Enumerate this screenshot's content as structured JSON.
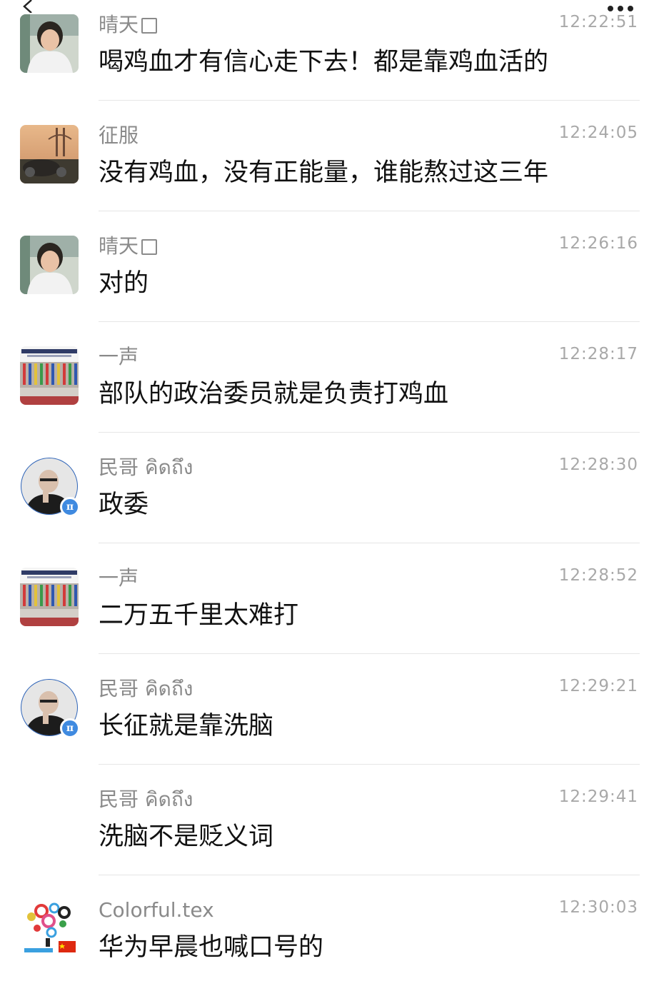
{
  "messages": [
    {
      "sender": "晴天",
      "sender_has_box": true,
      "time": "12:22:51",
      "text": "喝鸡血才有信心走下去！都是靠鸡血活的",
      "avatar": "avatar-woman"
    },
    {
      "sender": "征服",
      "sender_has_box": false,
      "time": "12:24:05",
      "text": "没有鸡血，没有正能量，谁能熬过这三年",
      "avatar": "avatar-landscape"
    },
    {
      "sender": "晴天",
      "sender_has_box": true,
      "time": "12:26:16",
      "text": "对的",
      "avatar": "avatar-woman"
    },
    {
      "sender": "一声",
      "sender_has_box": false,
      "time": "12:28:17",
      "text": "部队的政治委员就是负责打鸡血",
      "avatar": "avatar-summit"
    },
    {
      "sender": "民哥 คิดถึง",
      "sender_has_box": false,
      "time": "12:28:30",
      "text": "政委",
      "avatar": "avatar-man"
    },
    {
      "sender": "一声",
      "sender_has_box": false,
      "time": "12:28:52",
      "text": "二万五千里太难打",
      "avatar": "avatar-summit"
    },
    {
      "sender": "民哥 คิดถึง",
      "sender_has_box": false,
      "time": "12:29:21",
      "text": "长征就是靠洗脑",
      "avatar": "avatar-man"
    },
    {
      "sender": "民哥 คิดถึง",
      "sender_has_box": false,
      "time": "12:29:41",
      "text": "洗脑不是贬义词",
      "avatar": "none"
    },
    {
      "sender": "Colorful.tex",
      "sender_has_box": false,
      "time": "12:30:03",
      "text": "华为早晨也喊口号的",
      "avatar": "avatar-colorful"
    }
  ],
  "icons": {
    "back": "chevron-left-icon",
    "more": "more-dots-icon",
    "verified": "verified-badge-icon"
  },
  "colors": {
    "sender": "#8a8a8a",
    "time": "#a8a8a8",
    "text": "#111111",
    "badge": "#3f8ae0"
  }
}
